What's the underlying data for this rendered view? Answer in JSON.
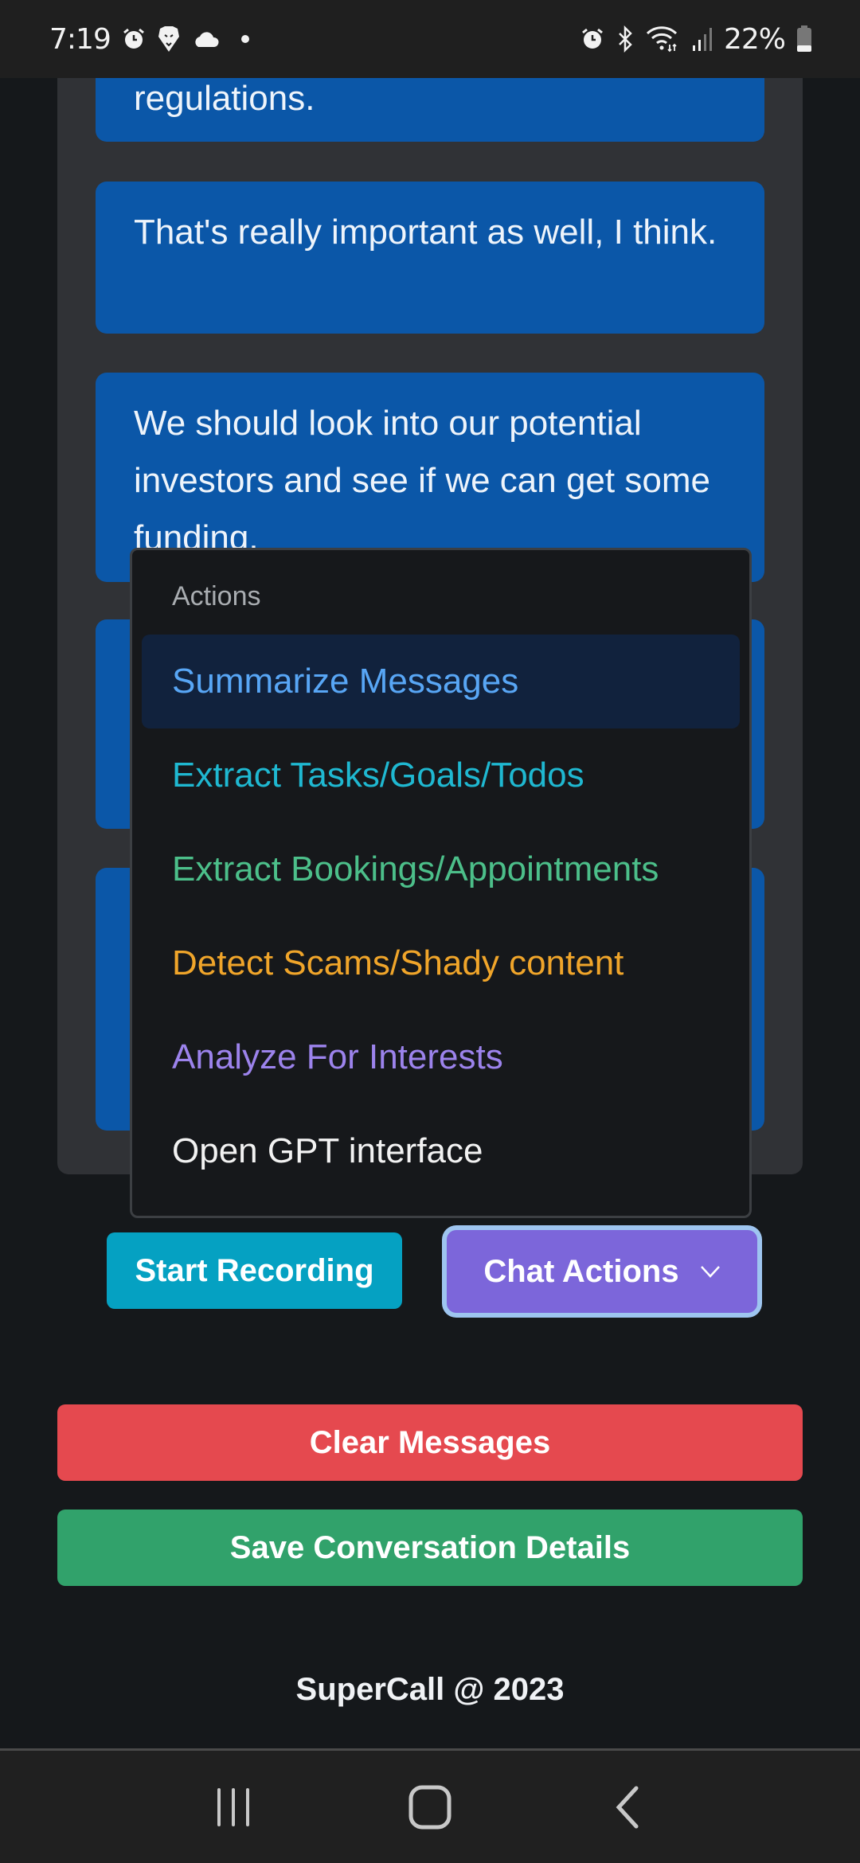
{
  "status_bar": {
    "time": "7:19",
    "left_icons": [
      "alarm-icon",
      "brave-lion-icon",
      "cloud-icon",
      "notification-dot"
    ],
    "right_icons": [
      "alarm-icon",
      "bluetooth-icon",
      "wifi-icon",
      "signal-icon"
    ],
    "battery_percent": "22%"
  },
  "chat": {
    "messages": [
      {
        "text": "regulations."
      },
      {
        "text": "That's really important as well, I think."
      },
      {
        "text": "We should look into our potential investors and see if we can get some funding."
      },
      {
        "text": ""
      },
      {
        "text": ""
      }
    ]
  },
  "dropdown": {
    "header": "Actions",
    "items": [
      {
        "label": "Summarize Messages",
        "color": "#58a6f5",
        "active": true
      },
      {
        "label": "Extract Tasks/Goals/Todos",
        "color": "#1fb8d1",
        "active": false
      },
      {
        "label": "Extract Bookings/Appointments",
        "color": "#4cbf8a",
        "active": false
      },
      {
        "label": "Detect Scams/Shady content",
        "color": "#f0a52a",
        "active": false
      },
      {
        "label": "Analyze For Interests",
        "color": "#9c83ec",
        "active": false
      },
      {
        "label": "Open GPT interface",
        "color": "#f2f2f2",
        "active": false
      }
    ]
  },
  "controls": {
    "start_recording": "Start Recording",
    "chat_actions": "Chat Actions",
    "clear_messages": "Clear Messages",
    "save_conversation": "Save Conversation Details"
  },
  "colors": {
    "bubble": "#0b57a8",
    "record": "#05a1c2",
    "chat_actions": "#7c66da",
    "clear": "#e5494f",
    "save": "#31a26b"
  },
  "footer": {
    "text": "SuperCall @ 2023"
  },
  "nav_bar": {
    "buttons": [
      "recent-apps-icon",
      "home-icon",
      "back-icon"
    ]
  }
}
